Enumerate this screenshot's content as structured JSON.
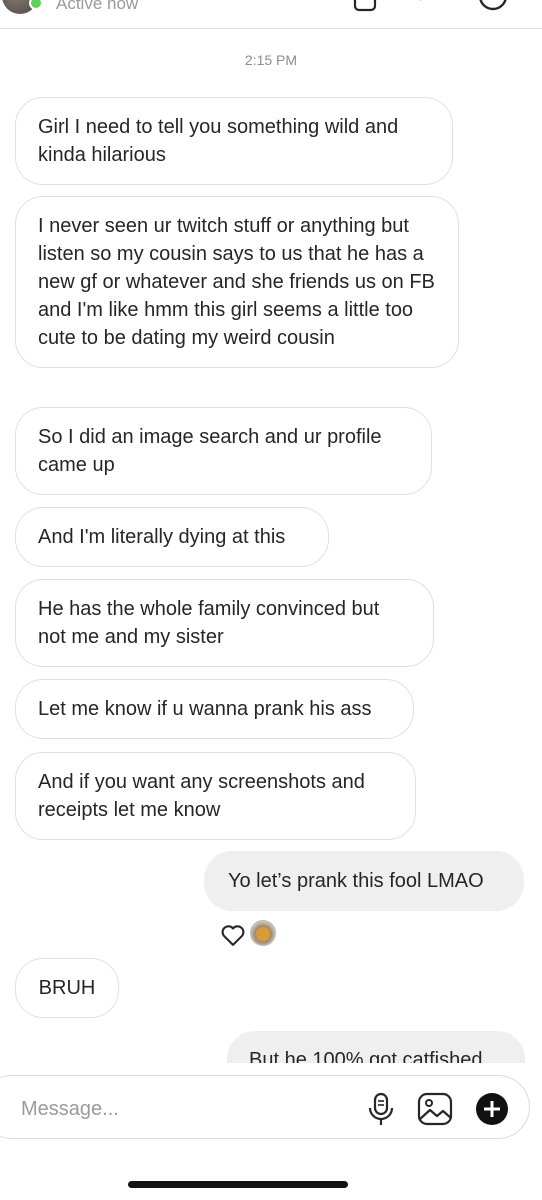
{
  "header": {
    "status": "Active now",
    "icons": [
      "avatar",
      "video-icon",
      "phone-icon",
      "info-icon"
    ]
  },
  "conversation": {
    "timestamp": "2:15 PM",
    "messages": [
      {
        "sender": "them",
        "text": "Girl I need to tell you something wild and kinda hilarious"
      },
      {
        "sender": "them",
        "text": "I never seen ur twitch stuff or anything but listen so my cousin says to us that he has a new gf or whatever and she friends us on FB and I'm like hmm this girl seems a little too cute to be dating my weird cousin"
      },
      {
        "sender": "them",
        "text": "So I did an image search and ur profile came up"
      },
      {
        "sender": "them",
        "text": "And I'm literally dying at this"
      },
      {
        "sender": "them",
        "text": "He has the whole family convinced but not me and my sister"
      },
      {
        "sender": "them",
        "text": "Let me know if u wanna prank his ass"
      },
      {
        "sender": "them",
        "text": "And if you want any screenshots and receipts let me know"
      },
      {
        "sender": "me",
        "text": "Yo let’s prank this fool LMAO"
      },
      {
        "sender": "them",
        "text": "BRUH"
      },
      {
        "sender": "me",
        "text": "But he 100% got catfished"
      }
    ],
    "reaction": {
      "emoji": "heart-icon"
    }
  },
  "composer": {
    "placeholder": "Message...",
    "icons": [
      "microphone-icon",
      "gallery-icon",
      "add-icon"
    ]
  }
}
